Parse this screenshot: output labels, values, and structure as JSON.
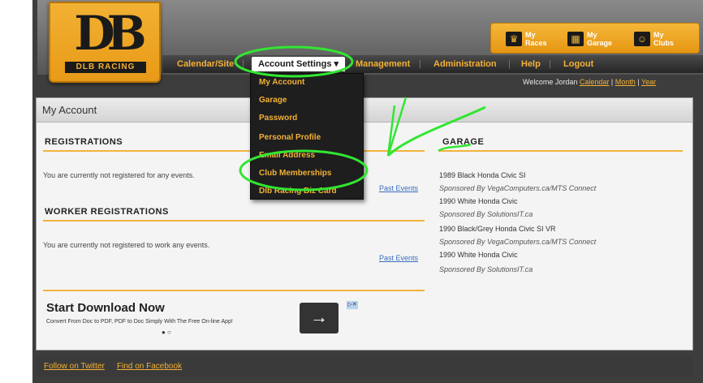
{
  "brand": {
    "logo_mark": "DB",
    "logo_text": "DLB RACING"
  },
  "top_tabs": [
    {
      "label": "My Races",
      "icon": "trophy-icon"
    },
    {
      "label": "My Garage",
      "icon": "garage-icon"
    },
    {
      "label": "My Clubs",
      "icon": "clubs-icon"
    }
  ],
  "nav": {
    "calendar": "Calendar/Site",
    "account_settings": "Account Settings ▾",
    "management": "Management",
    "administration": "Administration",
    "help": "Help",
    "logout": "Logout"
  },
  "welcome": {
    "text": "Welcome Jordan",
    "calendar": "Calendar",
    "month": "Month",
    "year": "Year"
  },
  "dropdown": {
    "items": [
      "My Account",
      "Garage",
      "Password",
      "Personal Profile",
      "Email Address",
      "Club Memberships",
      "Dlb Racing Biz Card"
    ]
  },
  "page": {
    "title": "My Account",
    "registrations_head": "REGISTRATIONS",
    "registrations_text": "You are currently not registered for any events.",
    "past_events": "Past Events",
    "worker_head": "WORKER REGISTRATIONS",
    "worker_text": "You are currently not registered to work any events.",
    "garage_head": "GARAGE",
    "garage_lines": [
      "1989 Black Honda Civic SI",
      "Sponsored By VegaComputers.ca/MTS Connect",
      "1990 White Honda Civic",
      "Sponsored By SolutionsIT.ca",
      "1990 Black/Grey Honda Civic SI VR",
      "Sponsored By VegaComputers.ca/MTS Connect",
      "1990 White Honda Civic",
      "Sponsored By SolutionsIT.ca"
    ]
  },
  "ad": {
    "title": "Start Download Now",
    "subtitle": "Convert From Doc to PDF, PDF to Doc Simply With The Free On-line App!",
    "dots": "● ○",
    "arrow": "→",
    "badge": "▷✕"
  },
  "footer": {
    "twitter": "Follow on Twitter",
    "facebook": "Find on Facebook"
  },
  "colors": {
    "accent": "#f3b133",
    "annotation": "#32e632",
    "link": "#3a6fbf"
  }
}
